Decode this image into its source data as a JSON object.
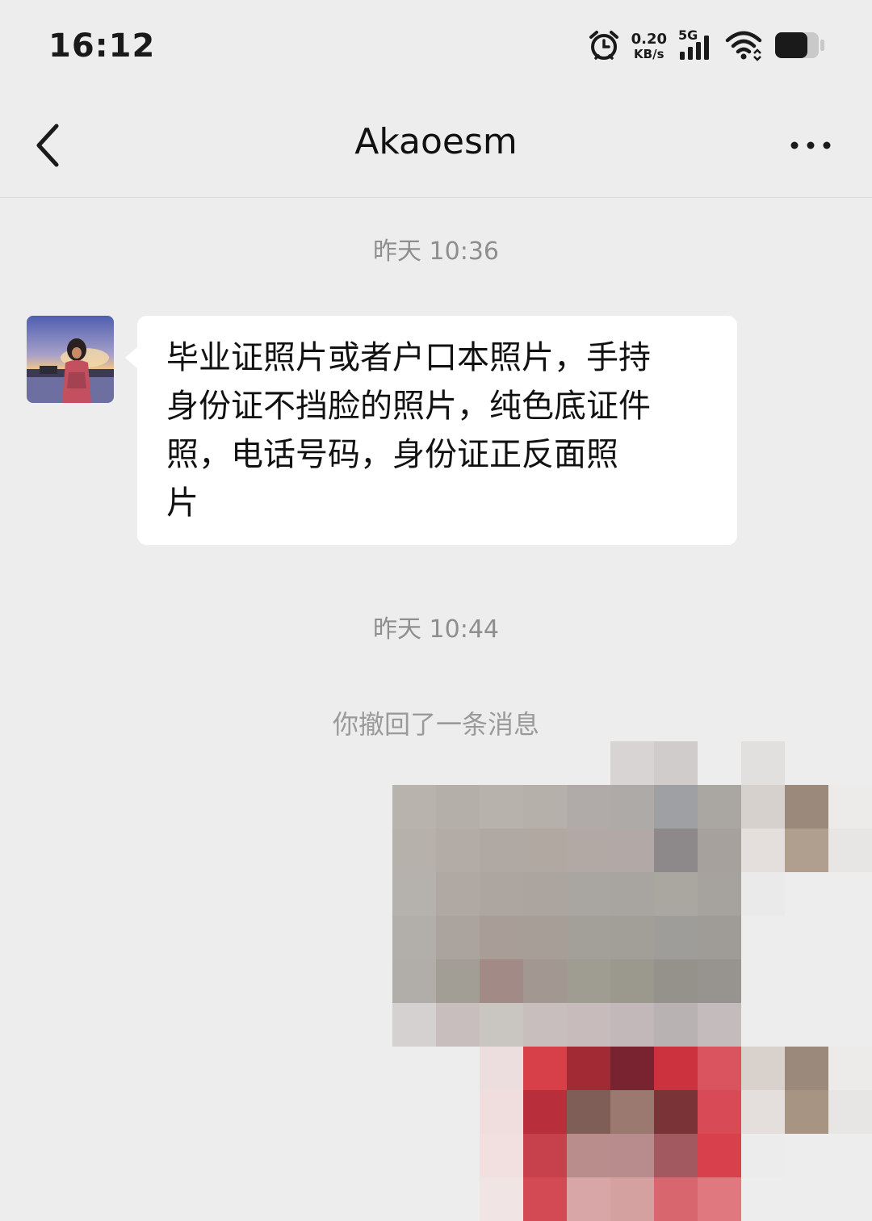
{
  "status_bar": {
    "time": "16:12",
    "net_speed_value": "0.20",
    "net_speed_unit": "KB/s",
    "network_type": "5G",
    "icons": [
      "alarm-icon",
      "signal-icon",
      "wifi-icon",
      "battery-icon"
    ]
  },
  "nav": {
    "title": "Akaoesm",
    "back_icon": "chevron-left-icon",
    "more_icon": "more-horizontal-icon"
  },
  "messages": [
    {
      "type": "timestamp",
      "text": "昨天 10:36"
    },
    {
      "type": "incoming",
      "sender_avatar": "avatar",
      "lines": [
        "毕业证照片或者户口本照片，手持",
        "身份证不挡脸的照片，纯色底证件",
        "照，电话号码，身份证正反面照",
        "片"
      ]
    },
    {
      "type": "timestamp",
      "text": "昨天 10:44"
    },
    {
      "type": "recall",
      "text": "你撤回了一条消息"
    },
    {
      "type": "outgoing-image",
      "state": "pixelated"
    }
  ],
  "colors": {
    "background": "#ededed",
    "bubble_incoming": "#ffffff",
    "timestamp_text": "#8e8e8e"
  }
}
